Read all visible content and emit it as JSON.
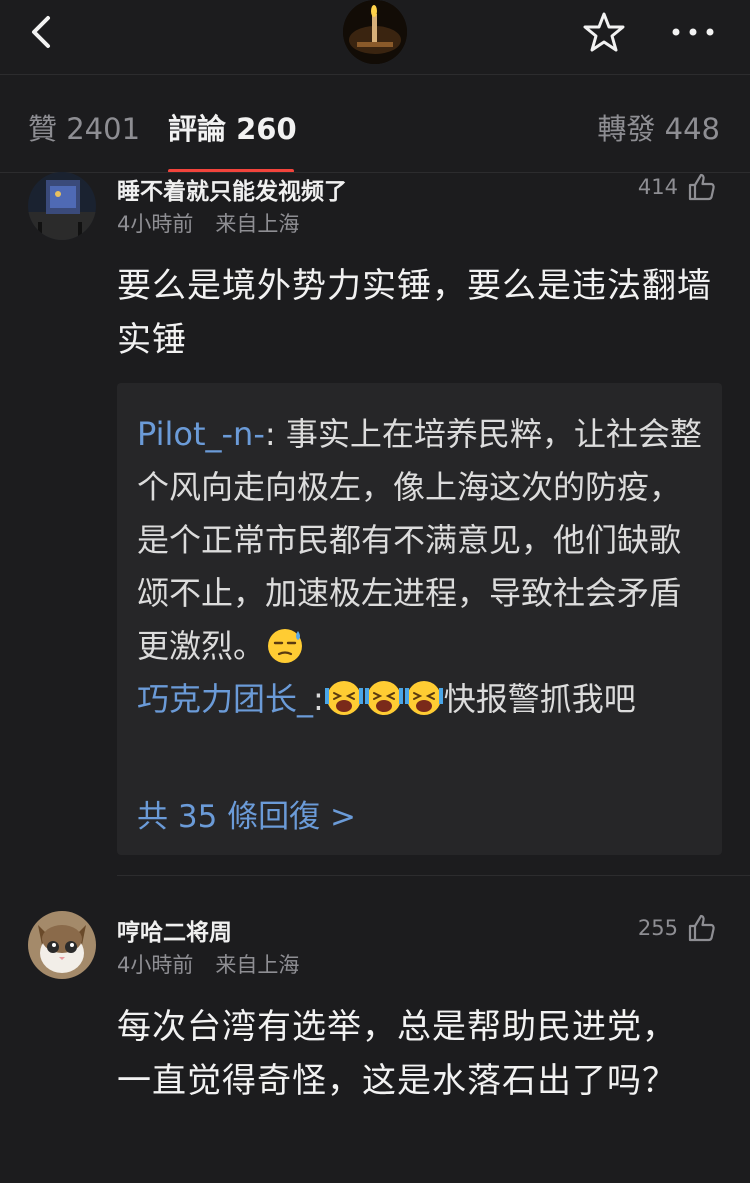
{
  "tabs": {
    "likes": "贊 2401",
    "comments": "評論 260",
    "reposts": "轉發 448"
  },
  "comments": [
    {
      "username": "睡不着就只能发视频了",
      "time": "4小時前",
      "location": "来自上海",
      "likes": "414",
      "text": "要么是境外势力实锤，要么是违法翻墙实锤",
      "replies": [
        {
          "name": "Pilot_-n-",
          "text": ": 事实上在培养民粹，让社会整个风向走向极左，像上海这次的防疫，是个正常市民都有不满意见，他们缺歌颂不止，加速极左进程，导致社会矛盾更激烈。"
        },
        {
          "name": "巧克力团长_",
          "text": ":",
          "after": "快报警抓我吧"
        }
      ],
      "more_replies": "共 35 條回復 >"
    },
    {
      "username": "哼哈二将周",
      "time": "4小時前",
      "location": "来自上海",
      "likes": "255",
      "text": "每次台湾有选举，总是帮助民进党，一直觉得奇怪，这是水落石出了吗？"
    }
  ],
  "icons": {
    "back": "chevron-left-icon",
    "favorite": "star-icon",
    "more": "more-dots-icon",
    "like": "thumbs-up-icon"
  }
}
